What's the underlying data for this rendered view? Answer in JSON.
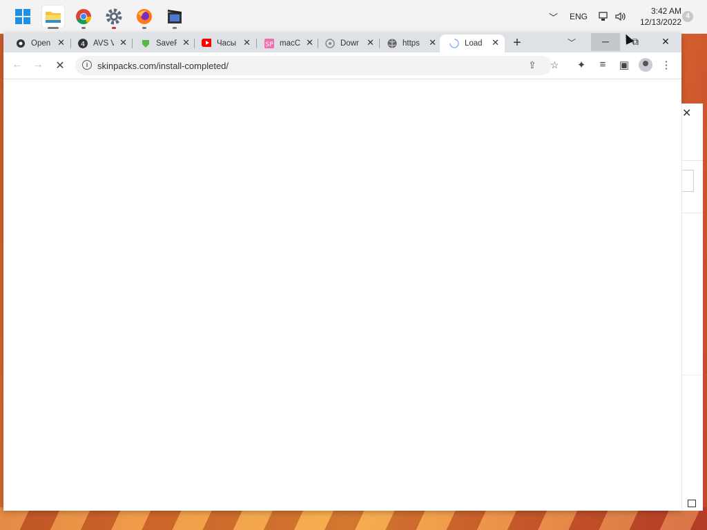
{
  "taskbar": {
    "apps": [
      {
        "name": "start"
      },
      {
        "name": "file-explorer"
      },
      {
        "name": "chrome"
      },
      {
        "name": "settings"
      },
      {
        "name": "firefox"
      },
      {
        "name": "video-app"
      }
    ],
    "language": "ENG",
    "time": "3:42 AM",
    "date": "12/13/2022",
    "notification_count": "4"
  },
  "tabs": [
    {
      "title": "Open",
      "icon": "openai-icon"
    },
    {
      "title": "AVS V",
      "icon": "avs-icon"
    },
    {
      "title": "SaveF",
      "icon": "savefrom-icon"
    },
    {
      "title": "Часы",
      "icon": "youtube-icon"
    },
    {
      "title": "macC",
      "icon": "sp-icon"
    },
    {
      "title": "Dowr",
      "icon": "download-icon"
    },
    {
      "title": "https",
      "icon": "globe-icon"
    },
    {
      "title": "Load",
      "icon": "spinner-icon"
    }
  ],
  "toolbar": {
    "url": "skinpacks.com/install-completed/"
  },
  "colors": {
    "tabstrip": "#dee1e6",
    "taskbar": "#f3f3f3",
    "youtube_red": "#ff0000",
    "savefrom_green": "#57b847"
  }
}
